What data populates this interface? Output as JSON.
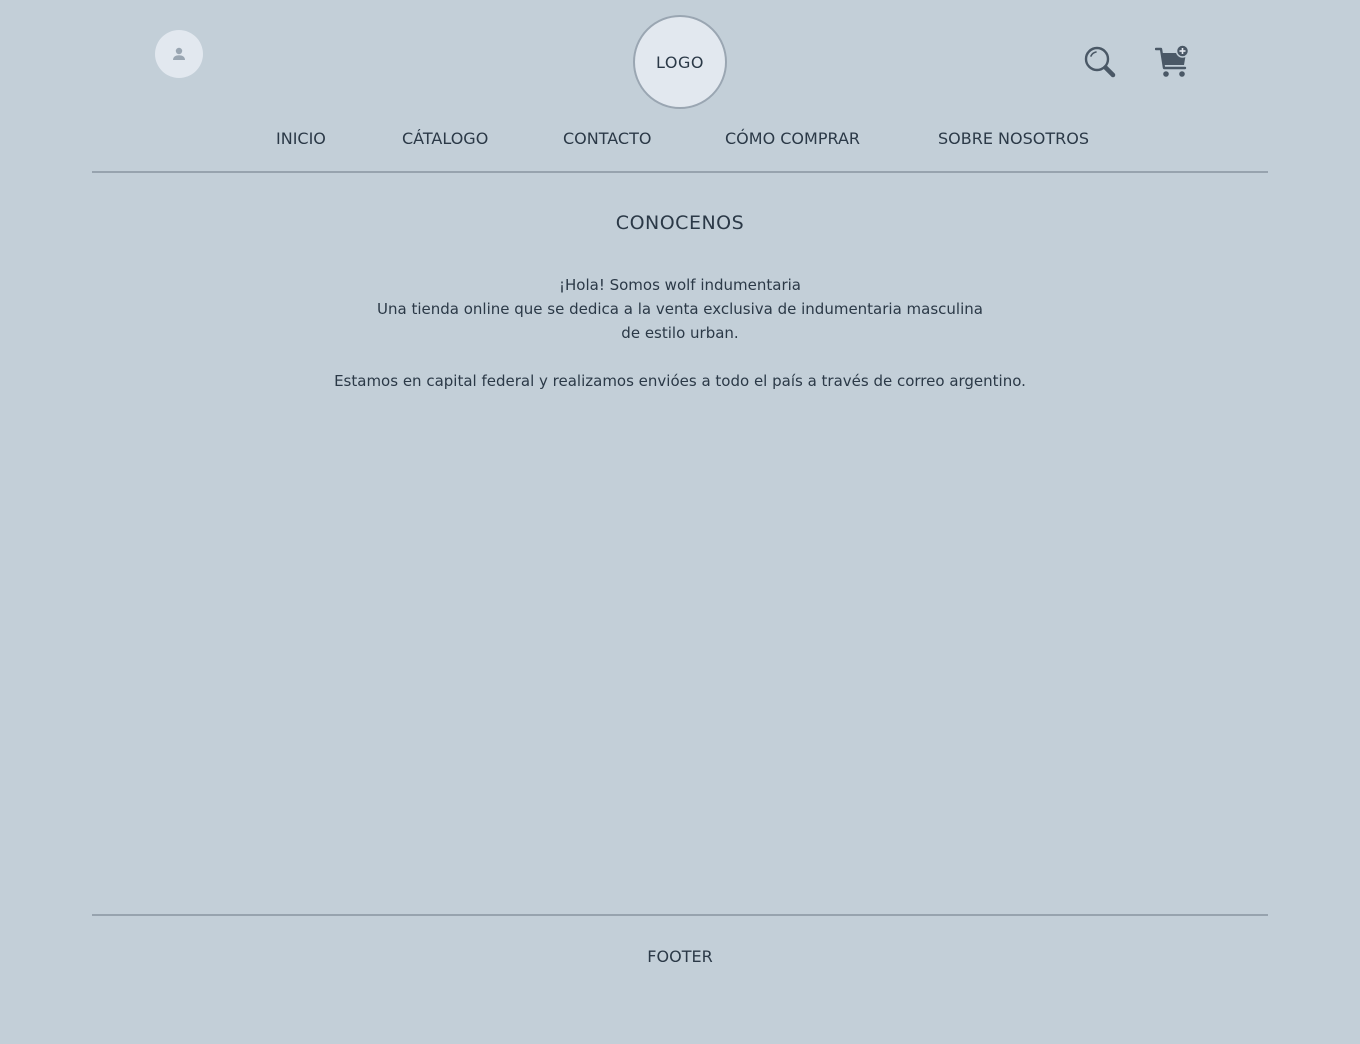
{
  "header": {
    "logo_text": "LOGO",
    "user_icon": "user-icon",
    "search_icon": "search-icon",
    "cart_icon": "cart-add-icon"
  },
  "nav": {
    "items": [
      {
        "label": "INICIO"
      },
      {
        "label": "CÁTALOGO"
      },
      {
        "label": "CONTACTO"
      },
      {
        "label": "CÓMO COMPRAR"
      },
      {
        "label": "SOBRE NOSOTROS"
      }
    ]
  },
  "main": {
    "title": "CONOCENOS",
    "paragraph1_line1": "¡Hola! Somos wolf indumentaria",
    "paragraph1_line2": "Una tienda online que se dedica a la venta exclusiva de indumentaria masculina",
    "paragraph1_line3": "de estilo urban.",
    "paragraph2": "Estamos en capital federal y realizamos envióes a todo el país a través de correo argentino."
  },
  "footer": {
    "label": "FOOTER"
  },
  "colors": {
    "background": "#c3cfd8",
    "text": "#2b3947",
    "circle_fill": "#e2e8ef",
    "divider": "#97a3ae",
    "icon": "#4a5866"
  }
}
